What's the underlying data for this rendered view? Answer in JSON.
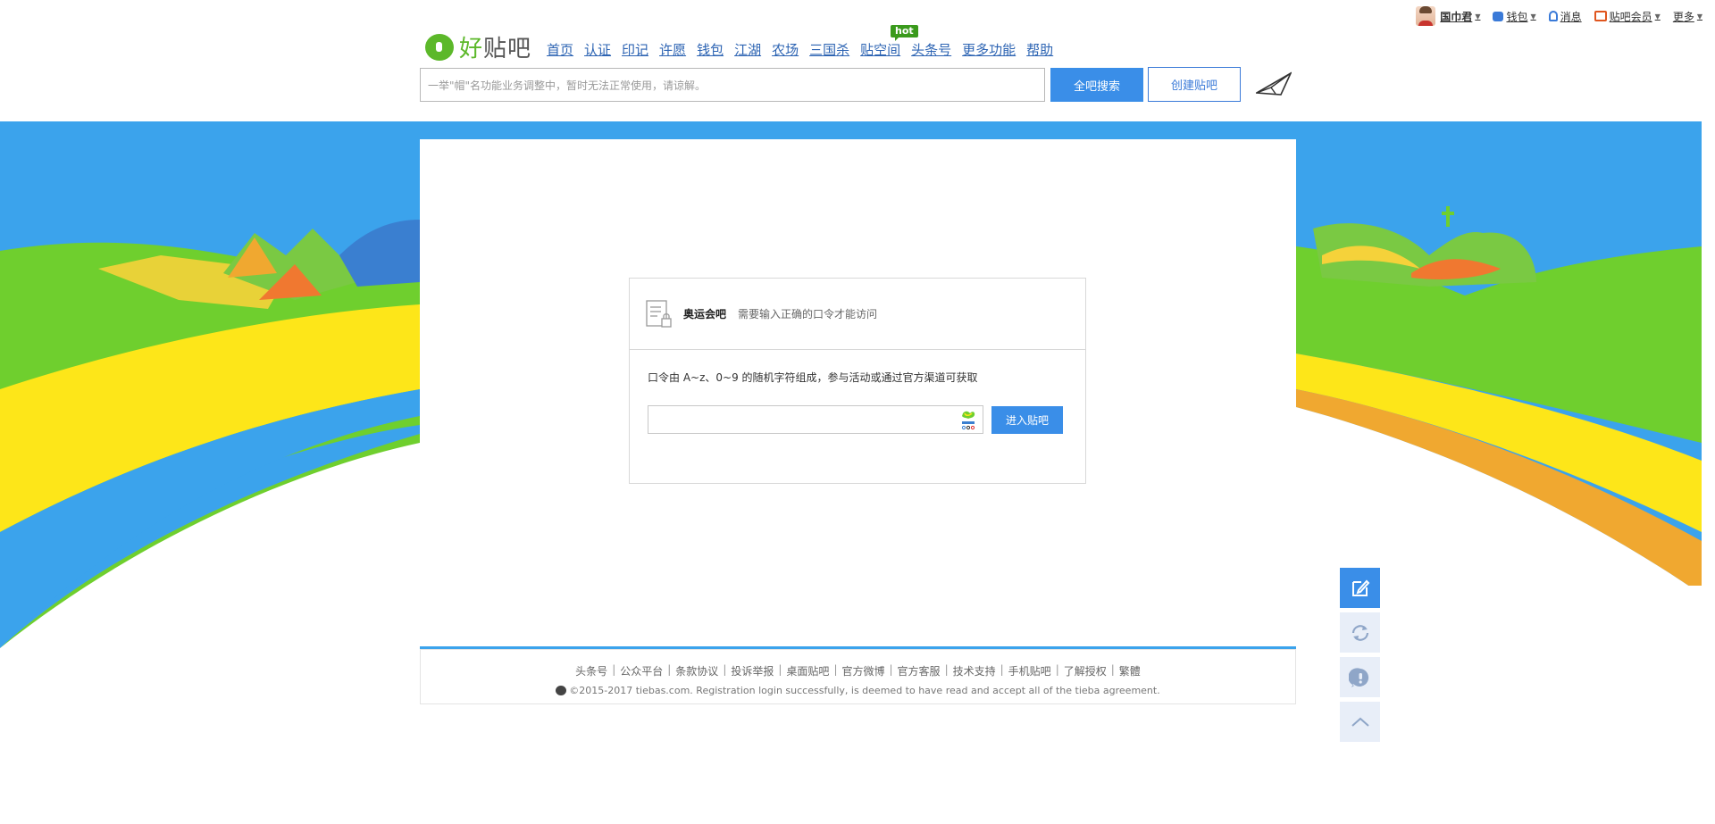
{
  "userbar": {
    "username": "国巾君",
    "wallet": "钱包",
    "messages": "消息",
    "vip": "贴吧会员",
    "more": "更多"
  },
  "logo": {
    "good": "好",
    "tieba": "贴吧"
  },
  "nav": {
    "items": [
      "首页",
      "认证",
      "印记",
      "许愿",
      "钱包",
      "江湖",
      "农场",
      "三国杀",
      "贴空间",
      "头条号",
      "更多功能",
      "帮助"
    ],
    "hot_badge": "hot"
  },
  "search": {
    "placeholder": "一举\"帽\"名功能业务调整中，暂时无法正常使用，请谅解。",
    "search_button": "全吧搜索",
    "create_button": "创建贴吧"
  },
  "card": {
    "title": "奥运会吧",
    "subtitle": "需要输入正确的口令才能访问",
    "description": "口令由 A~z、0~9 的随机字符组成，参与活动或通过官方渠道可获取",
    "enter_button": "进入贴吧"
  },
  "footer": {
    "links": [
      "头条号",
      "公众平台",
      "条款协议",
      "投诉举报",
      "桌面贴吧",
      "官方微博",
      "官方客服",
      "技术支持",
      "手机贴吧",
      "了解授权",
      "繁體"
    ],
    "copyright": "©2015-2017 tiebas.com. Registration login successfully, is deemed to have read and accept all of the tieba agreement."
  },
  "colors": {
    "accent_blue": "#3a8ee8",
    "brand_green": "#5cb82a",
    "sky": "#3ba3ec",
    "grass": "#6fcf2e",
    "yellow": "#fde619",
    "orange": "#f0a830"
  }
}
